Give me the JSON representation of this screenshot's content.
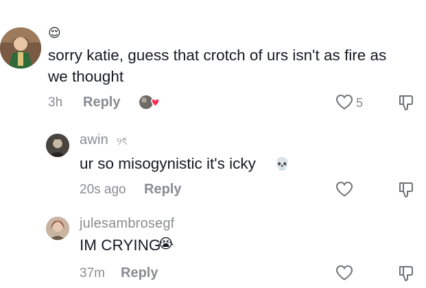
{
  "comments": [
    {
      "username_emoji": "😌",
      "text_line1": "sorry katie, guess that crotch of urs isn't as fire as",
      "text_line2": "we thought",
      "time": "3h",
      "reply_label": "Reply",
      "like_count": "5",
      "avatar_icon": "avatar-figure-icon",
      "liked_by_creator_icon": "creator-liked-heart-icon"
    },
    {
      "username": "awin",
      "username_decoration": "୨ৎ",
      "text": "ur so misogynistic it's icky",
      "text_emoji": "💀",
      "time": "20s ago",
      "reply_label": "Reply"
    },
    {
      "username": "julesambrosegf",
      "text": "IM CRYING",
      "text_emoji": "😭",
      "time": "37m",
      "reply_label": "Reply"
    }
  ],
  "colors": {
    "text": "#161823",
    "muted": "#8a8b91",
    "like_heart": "#fe2c55"
  }
}
